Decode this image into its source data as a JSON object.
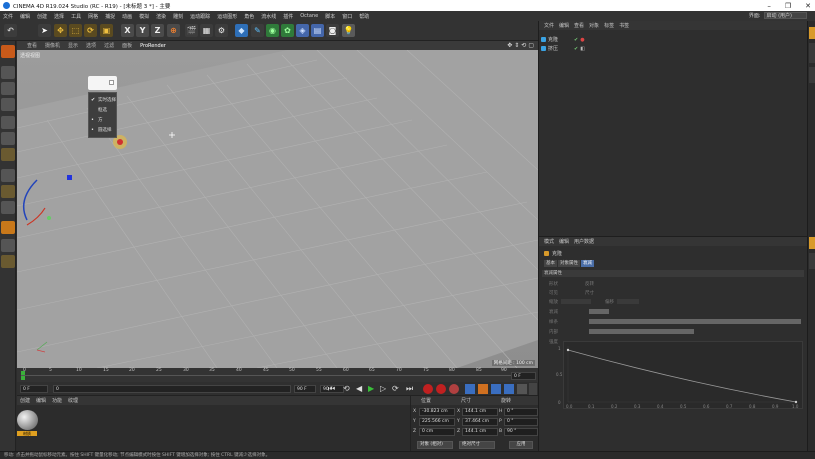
{
  "titlebar": {
    "title": "CINEMA 4D R19.024 Studio (RC - R19) - [未标题 3 *] - 主要"
  },
  "menu": [
    "文件",
    "编辑",
    "创建",
    "选择",
    "工具",
    "网格",
    "捕捉",
    "动画",
    "模拟",
    "渲染",
    "雕刻",
    "运动跟踪",
    "运动图形",
    "角色",
    "流水线",
    "插件",
    "Octane",
    "脚本",
    "窗口",
    "帮助"
  ],
  "layout": {
    "label": "界面:",
    "value": "启动 (用户)"
  },
  "viewport": {
    "menu": [
      "查看",
      "摄像机",
      "显示",
      "选项",
      "过滤",
      "面板",
      "ProRender"
    ],
    "label": "透视视图",
    "info": "网格间距 : 100 cm"
  },
  "context_menu": {
    "items": [
      "实时选择",
      "框选",
      "方",
      "圆选择"
    ]
  },
  "timeline": {
    "ticks": [
      "0",
      "5",
      "10",
      "15",
      "20",
      "25",
      "30",
      "35",
      "40",
      "45",
      "50",
      "55",
      "60",
      "65",
      "70",
      "75",
      "80",
      "85",
      "90"
    ],
    "end_frame": "0 F"
  },
  "transport": {
    "start": "0 F",
    "current": "0",
    "end_a": "90 F",
    "end_b": "90 F"
  },
  "material": {
    "tabs": [
      "创建",
      "编辑",
      "功能",
      "纹理"
    ],
    "name": "材质"
  },
  "coords": {
    "headers": [
      "位置",
      "尺寸",
      "旋转"
    ],
    "rows": [
      {
        "axis": "X",
        "pos": "-30.823 cm",
        "size_axis": "X",
        "size": "144.1 cm",
        "rot_axis": "H",
        "rot": "0 °"
      },
      {
        "axis": "Y",
        "pos": "225.566 cm",
        "size_axis": "Y",
        "size": "37.464 cm",
        "rot_axis": "P",
        "rot": "0 °"
      },
      {
        "axis": "Z",
        "pos": "0 cm",
        "size_axis": "Z",
        "size": "144.1 cm",
        "rot_axis": "B",
        "rot": "90 °"
      }
    ],
    "mode": "对象 (相对)",
    "size_mode": "绝对尺寸",
    "apply": "应用"
  },
  "status": "移动: 点击并拖动鼠标移动元素。按住 SHIFT 键量化移动; 节点编辑模式时按住 SHIFT 键增加选择对象; 按住 CTRL 键减少选择对象。",
  "objects": {
    "tabs": [
      "文件",
      "编辑",
      "查看",
      "对象",
      "标签",
      "书签"
    ],
    "items": [
      {
        "name": "克隆",
        "color": "#3aa3e3"
      },
      {
        "name": "挤压",
        "color": "#3aa3e3"
      }
    ]
  },
  "attributes": {
    "tabs": [
      "模式",
      "编辑",
      "用户数据"
    ],
    "object": "克隆",
    "subtabs": [
      "基本",
      "对象属性",
      "衰减"
    ],
    "active_subtab": "衰减",
    "section": "衰减属性",
    "props": [
      "形状",
      "反转",
      "可见",
      "尺寸",
      "缩放",
      "偏移",
      "衰减",
      "样条",
      "内部",
      "强度"
    ],
    "graph_x": [
      "0.0",
      "0.1",
      "0.2",
      "0.3",
      "0.4",
      "0.5",
      "0.6",
      "0.7",
      "0.8",
      "0.9",
      "1.0"
    ],
    "graph_y": [
      "1",
      "0.5",
      "0"
    ]
  },
  "colors": {
    "accent_orange": "#d89a2a",
    "tab_blue": "#4a6ea8",
    "viewport_grey": "#9a9a9a"
  }
}
